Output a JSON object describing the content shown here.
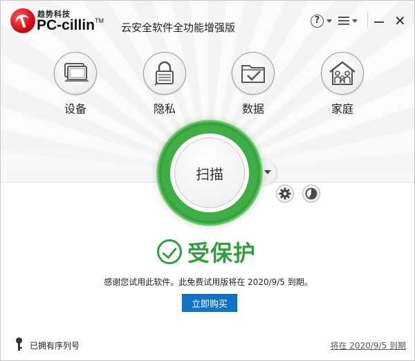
{
  "app": {
    "brand_small": "趋势科技",
    "brand_name": "PC-cillin",
    "brand_tm": "TM",
    "edition": "云安全软件全功能增强版",
    "help_symbol": "?",
    "close_symbol": "✕"
  },
  "features": [
    {
      "label": "设备",
      "icon": "laptop-icon"
    },
    {
      "label": "隐私",
      "icon": "lock-icon"
    },
    {
      "label": "数据",
      "icon": "folder-check-icon"
    },
    {
      "label": "家庭",
      "icon": "family-icon"
    }
  ],
  "scan": {
    "label": "扫描"
  },
  "status": {
    "text": "受保护",
    "color": "#2fa13a"
  },
  "trial": {
    "message": "感谢您试用此软件。此免费试用版将在 2020/9/5 到期。",
    "buy_label": "立即购买"
  },
  "footer": {
    "serial_label": "已拥有序列号",
    "expiry_label": "将在 2020/9/5 到期"
  },
  "colors": {
    "accent_blue": "#1273c9",
    "ok_green": "#2fa13a",
    "brand_red": "#d40a14"
  }
}
